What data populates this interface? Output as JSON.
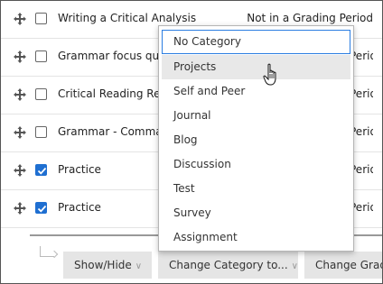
{
  "rows": [
    {
      "title": "Writing a Critical Analysis",
      "grading": "Not in a Grading Period",
      "checked": false
    },
    {
      "title": "Grammar focus quiz",
      "grading": "Period",
      "checked": false
    },
    {
      "title": "Critical Reading Review",
      "grading": "Period",
      "checked": false
    },
    {
      "title": "Grammar - Commas",
      "grading": "Period",
      "checked": false
    },
    {
      "title": "Practice",
      "grading": "Period",
      "checked": true
    },
    {
      "title": "Practice",
      "grading": "Period",
      "checked": true
    }
  ],
  "toolbar": {
    "show_hide": "Show/Hide",
    "change_category": "Change Category to...",
    "change_grading": "Change Grading Period"
  },
  "category_menu": {
    "options": [
      "No Category",
      "Projects",
      "Self and Peer",
      "Journal",
      "Blog",
      "Discussion",
      "Test",
      "Survey",
      "Assignment"
    ],
    "selected": "No Category",
    "hovered": "Projects"
  },
  "colors": {
    "accent": "#2a7de1",
    "checkbox_checked": "#1f6fd1",
    "button_bg": "#e5e5e5"
  },
  "icons": {
    "row_handle": "move-arrows-icon",
    "toolbar_chevron": "chevron-down-icon",
    "pointer": "hand-pointer-icon"
  }
}
